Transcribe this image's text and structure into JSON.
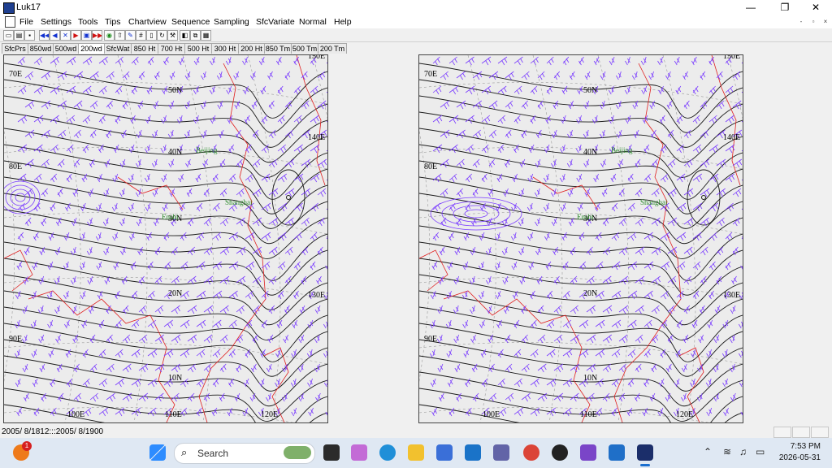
{
  "window": {
    "title": "Luk17",
    "minimize": "—",
    "restore": "❐",
    "close": "✕"
  },
  "menu": [
    "File",
    "Settings",
    "Tools",
    "Tips",
    "Chartview",
    "Sequence",
    "Sampling",
    "SfcVariate",
    "Normal",
    "Help"
  ],
  "mdi_controls": [
    "-",
    "▫",
    "×"
  ],
  "tabs": [
    {
      "label": "SfcPrs",
      "active": false
    },
    {
      "label": "850wd",
      "active": false
    },
    {
      "label": "500wd",
      "active": false
    },
    {
      "label": "200wd",
      "active": true
    },
    {
      "label": "SfcWat",
      "active": false
    },
    {
      "label": "850 Ht",
      "active": false
    },
    {
      "label": "700 Ht",
      "active": false
    },
    {
      "label": "500 Ht",
      "active": false
    },
    {
      "label": "300 Ht",
      "active": false
    },
    {
      "label": "200 Ht",
      "active": false
    },
    {
      "label": "850 Tm",
      "active": false
    },
    {
      "label": "500 Tm",
      "active": false
    },
    {
      "label": "200 Tm",
      "active": false
    }
  ],
  "maps": [
    {
      "lon_labels": [
        "70E",
        "80E",
        "90E",
        "100E",
        "110E",
        "120E",
        "130E",
        "140E",
        "150E"
      ],
      "lat_labels": [
        "50N",
        "40N",
        "30N",
        "20N",
        "10N"
      ],
      "cities": [
        "Beijing",
        "Shanghai",
        "Enshi"
      ]
    },
    {
      "lon_labels": [
        "70E",
        "80E",
        "90E",
        "100E",
        "110E",
        "120E",
        "130E",
        "140E",
        "150E"
      ],
      "lat_labels": [
        "50N",
        "40N",
        "30N",
        "20N",
        "10N"
      ],
      "cities": [
        "Beijing",
        "Shanghai",
        "Enshi"
      ]
    }
  ],
  "status": {
    "text": "2005/ 8/1812:::2005/ 8/1900"
  },
  "taskbar": {
    "search_placeholder": "Search",
    "time": "7:53 PM",
    "date": "2026-05-31",
    "notification_badge": "1"
  },
  "colors": {
    "contour": "#1a1a1a",
    "wind": "#7a3cff",
    "coast": "#e02020",
    "city": "#2a8a2a"
  }
}
